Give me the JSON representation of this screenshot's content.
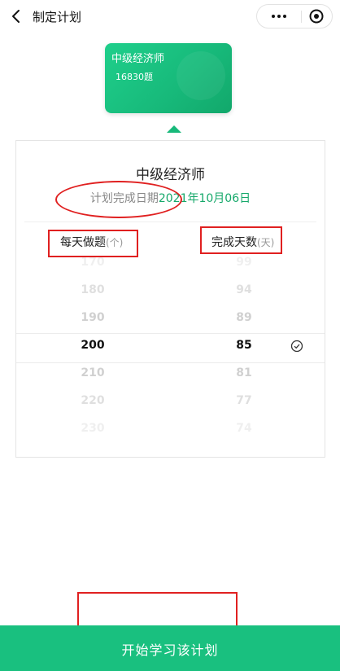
{
  "nav": {
    "title": "制定计划",
    "back_icon": "chevron-left-icon",
    "more_icon": "more-dots-icon",
    "close_icon": "target-circle-icon"
  },
  "exam_card": {
    "title": "中级经济师",
    "count": "16830题"
  },
  "panel": {
    "title": "中级经济师",
    "finish_label": "计划完成日期",
    "finish_date": "2021年10月06日",
    "left_header": {
      "label": "每天做题",
      "unit": "(个)"
    },
    "right_header": {
      "label": "完成天数",
      "unit": "(天)"
    },
    "rows": [
      {
        "per_day": "170",
        "days": "99",
        "opacity": 0.15
      },
      {
        "per_day": "180",
        "days": "94",
        "opacity": 0.3
      },
      {
        "per_day": "190",
        "days": "89",
        "opacity": 0.45
      },
      {
        "per_day": "200",
        "days": "85",
        "opacity": 1.0,
        "selected": true
      },
      {
        "per_day": "210",
        "days": "81",
        "opacity": 0.45
      },
      {
        "per_day": "220",
        "days": "77",
        "opacity": 0.3
      },
      {
        "per_day": "230",
        "days": "74",
        "opacity": 0.15
      }
    ]
  },
  "cta": {
    "label": "开始学习该计划"
  },
  "colors": {
    "accent": "#19c07f",
    "date_green": "#15a86a",
    "annotation_red": "#e02020"
  }
}
